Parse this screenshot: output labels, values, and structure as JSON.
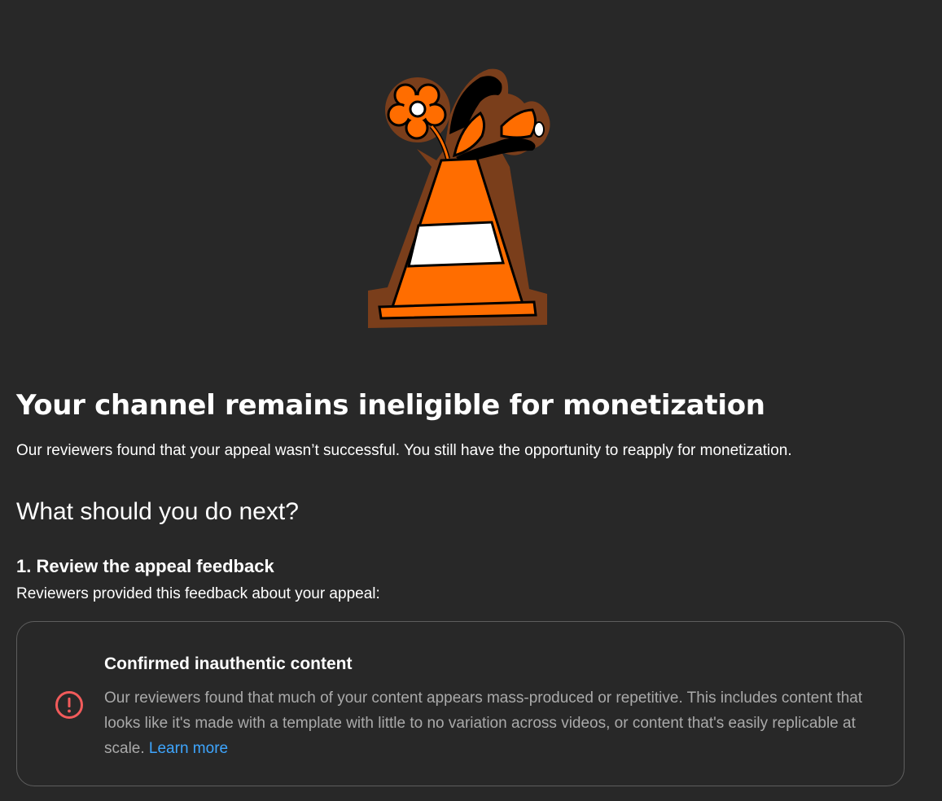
{
  "illustration": {
    "icon": "traffic-cone-with-flowers-illustration",
    "colors": {
      "cone": "#ff6d00",
      "outline": "#7a3e1b",
      "stripe": "#ffffff"
    }
  },
  "header": {
    "title": "Your channel remains ineligible for monetization",
    "subtitle": "Our reviewers found that your appeal wasn’t successful. You still have the opportunity to reapply for monetization."
  },
  "next_steps": {
    "heading": "What should you do next?",
    "step1": {
      "heading": "1. Review the appeal feedback",
      "description": "Reviewers provided this feedback about your appeal:"
    }
  },
  "feedback_card": {
    "icon": "alert-circle-icon",
    "icon_color": "#f25b5b",
    "title": "Confirmed inauthentic content",
    "body": "Our reviewers found that much of your content appears mass-produced or repetitive. This includes content that looks like it's made with a template with little to no variation across videos, or content that's easily replicable at scale.",
    "link_label": "Learn more",
    "link_color": "#3ea6ff"
  }
}
